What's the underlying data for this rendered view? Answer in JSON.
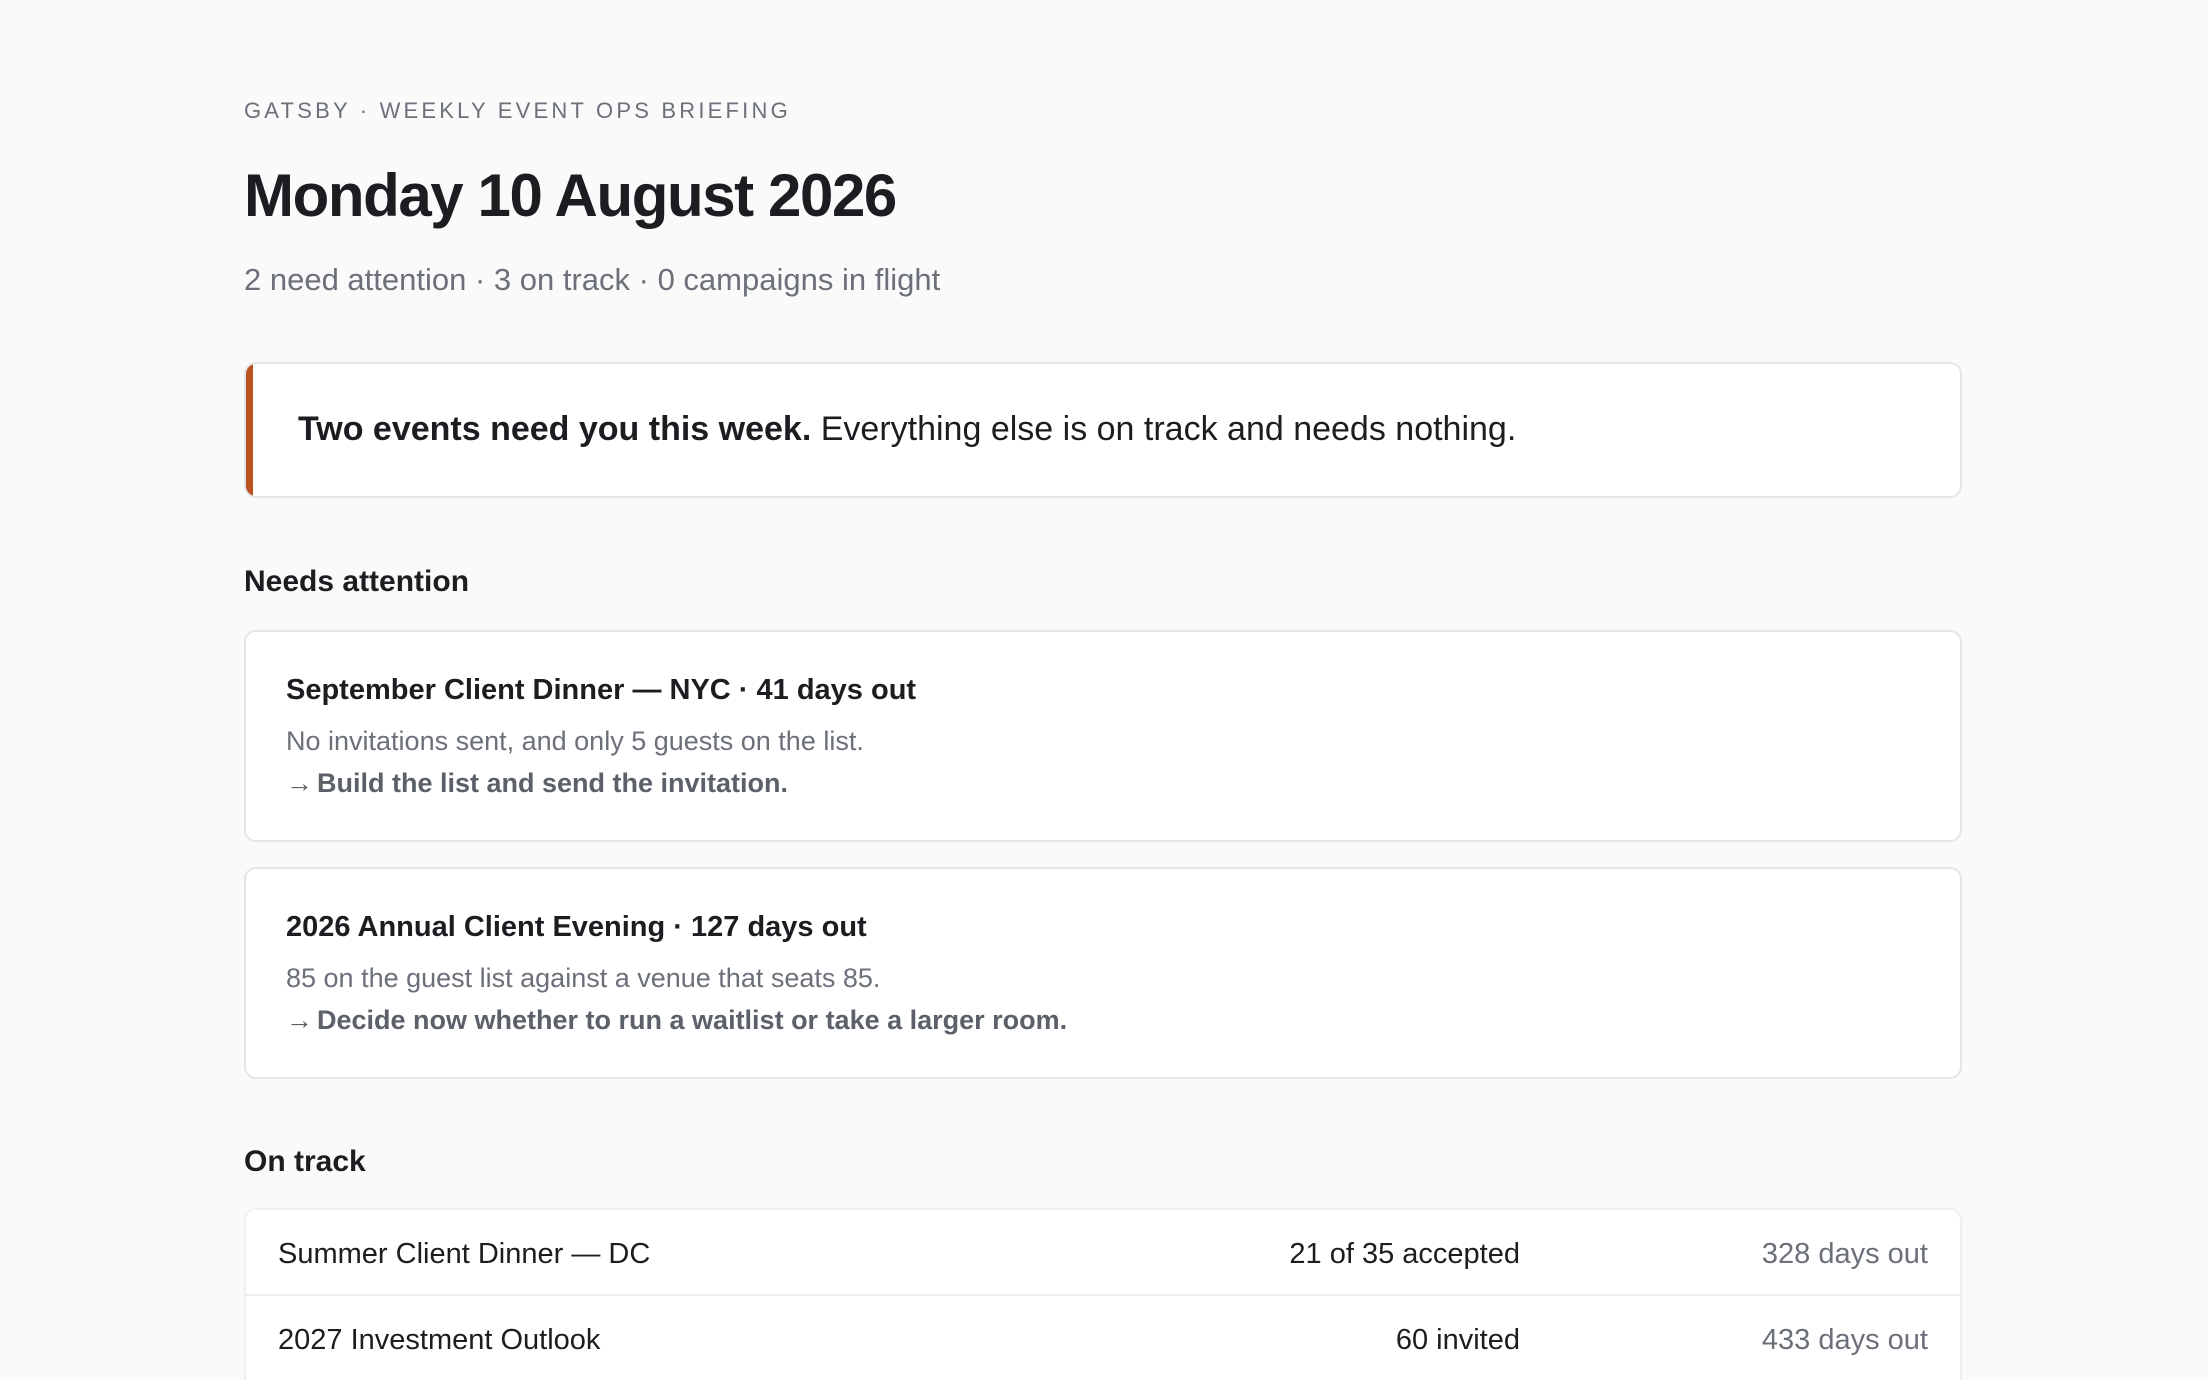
{
  "header": {
    "eyebrow": "GATSBY · WEEKLY EVENT OPS BRIEFING",
    "title": "Monday 10 August 2026",
    "summary": "2 need attention · 3 on track · 0 campaigns in flight"
  },
  "callout": {
    "bold": "Two events need you this week.",
    "rest": " Everything else is on track and needs nothing.",
    "accent_color": "#b8521e"
  },
  "needs_attention": {
    "heading": "Needs attention",
    "cards": [
      {
        "title": "September Client Dinner — NYC · 41 days out",
        "desc": "No invitations sent, and only 5 guests on the list.",
        "arrow": "→",
        "action": "Build the list and send the invitation."
      },
      {
        "title": "2026 Annual Client Evening · 127 days out",
        "desc": "85 on the guest list against a venue that seats 85.",
        "arrow": "→",
        "action": "Decide now whether to run a waitlist or take a larger room."
      }
    ]
  },
  "on_track": {
    "heading": "On track",
    "rows": [
      {
        "name": "Summer Client Dinner — DC",
        "status": "21 of 35 accepted",
        "days": "328 days out"
      },
      {
        "name": "2027 Investment Outlook",
        "status": "60 invited",
        "days": "433 days out"
      }
    ]
  }
}
